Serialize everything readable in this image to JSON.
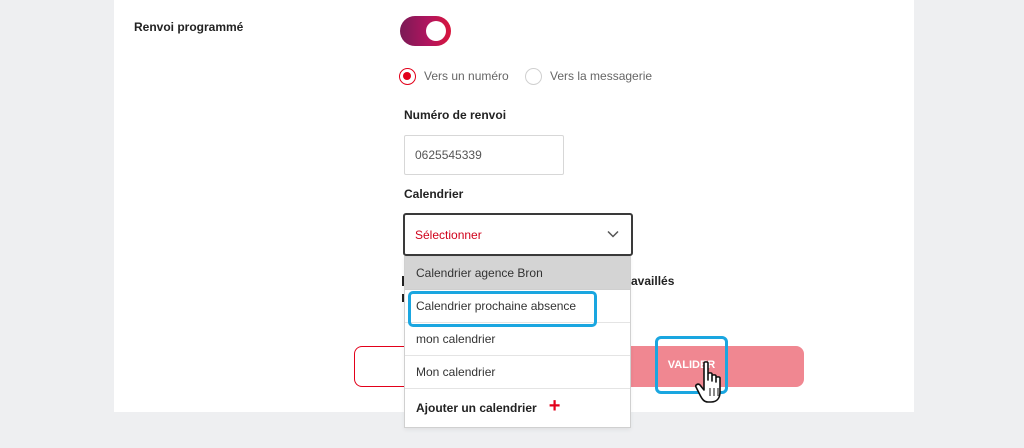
{
  "form": {
    "section_label": "Renvoi programmé",
    "toggle_on": true,
    "radio_options": [
      {
        "label": "Vers un numéro",
        "checked": true
      },
      {
        "label": "Vers la messagerie",
        "checked": false
      }
    ],
    "forward_number_label": "Numéro de renvoi",
    "forward_number_value": "0625545339",
    "calendar_label": "Calendrier",
    "calendar_placeholder": "Sélectionner",
    "partially_hidden_text": "availlés"
  },
  "dropdown": {
    "items": [
      "Calendrier agence Bron",
      "Calendrier prochaine absence",
      "mon calendrier",
      "Mon calendrier"
    ],
    "add_label": "Ajouter un calendrier"
  },
  "buttons": {
    "valider_label": "VALIDER"
  },
  "colors": {
    "accent_red": "#e2001a",
    "highlight_blue": "#1aa6e0",
    "valider_bg": "#f08791"
  },
  "icons": [
    "chevron-down-icon",
    "plus-icon",
    "hand-pointer-icon"
  ]
}
